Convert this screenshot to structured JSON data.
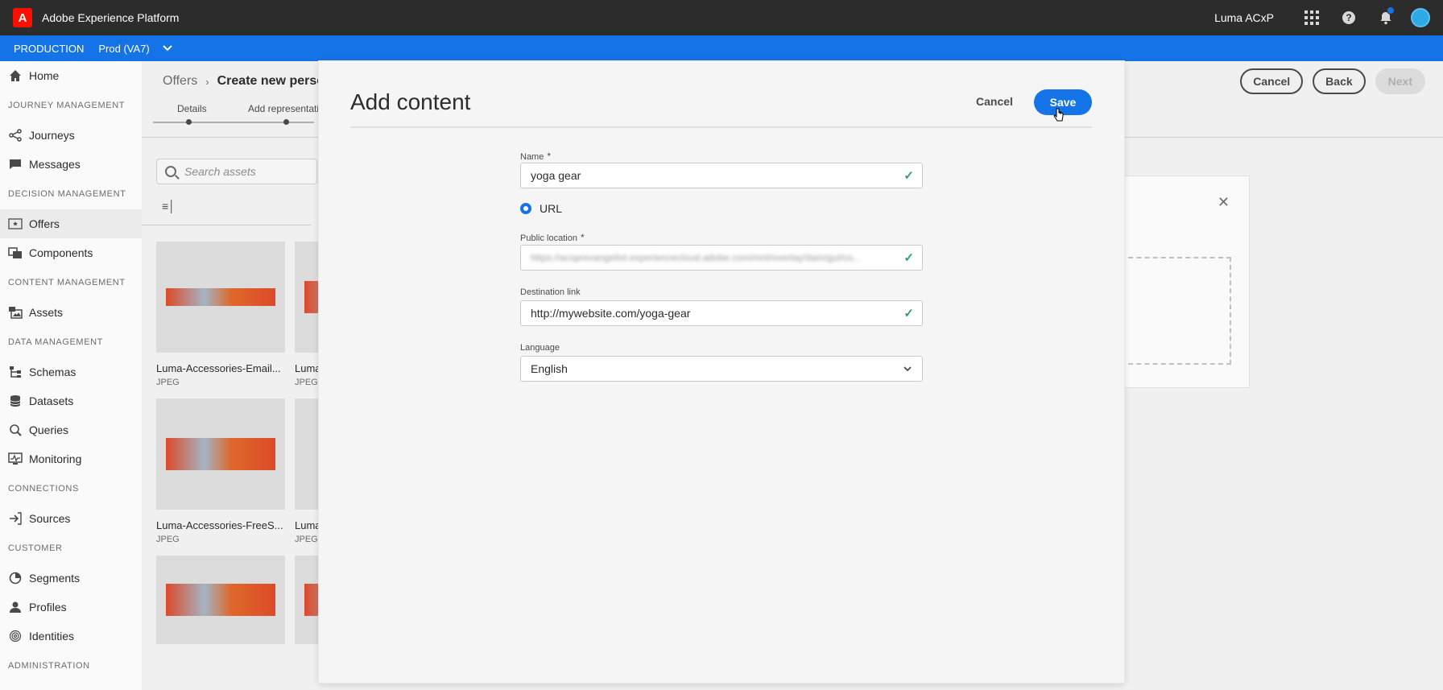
{
  "topbar": {
    "app_title": "Adobe Experience Platform",
    "org_name": "Luma ACxP",
    "icons": [
      "adobe-logo-icon",
      "apps-grid-icon",
      "help-icon",
      "bell-icon",
      "avatar"
    ]
  },
  "envbar": {
    "environment": "PRODUCTION",
    "sandbox": "Prod (VA7)"
  },
  "sidebar": {
    "items": [
      {
        "type": "item",
        "label": "Home",
        "icon": "home-icon"
      },
      {
        "type": "section",
        "label": "JOURNEY MANAGEMENT"
      },
      {
        "type": "item",
        "label": "Journeys",
        "icon": "journeys-icon"
      },
      {
        "type": "item",
        "label": "Messages",
        "icon": "messages-icon"
      },
      {
        "type": "section",
        "label": "DECISION MANAGEMENT"
      },
      {
        "type": "item",
        "label": "Offers",
        "icon": "offers-icon",
        "active": true
      },
      {
        "type": "item",
        "label": "Components",
        "icon": "components-icon"
      },
      {
        "type": "section",
        "label": "CONTENT MANAGEMENT"
      },
      {
        "type": "item",
        "label": "Assets",
        "icon": "assets-icon"
      },
      {
        "type": "section",
        "label": "DATA MANAGEMENT"
      },
      {
        "type": "item",
        "label": "Schemas",
        "icon": "schemas-icon"
      },
      {
        "type": "item",
        "label": "Datasets",
        "icon": "datasets-icon"
      },
      {
        "type": "item",
        "label": "Queries",
        "icon": "queries-icon"
      },
      {
        "type": "item",
        "label": "Monitoring",
        "icon": "monitoring-icon"
      },
      {
        "type": "section",
        "label": "CONNECTIONS"
      },
      {
        "type": "item",
        "label": "Sources",
        "icon": "sources-icon"
      },
      {
        "type": "section",
        "label": "CUSTOMER"
      },
      {
        "type": "item",
        "label": "Segments",
        "icon": "segments-icon"
      },
      {
        "type": "item",
        "label": "Profiles",
        "icon": "profiles-icon"
      },
      {
        "type": "item",
        "label": "Identities",
        "icon": "identities-icon"
      },
      {
        "type": "section",
        "label": "ADMINISTRATION"
      }
    ]
  },
  "background": {
    "breadcrumb": {
      "parent": "Offers",
      "current": "Create new persona"
    },
    "buttons": {
      "cancel": "Cancel",
      "back": "Back",
      "next": "Next"
    },
    "steps": [
      "Details",
      "Add representation"
    ],
    "search_placeholder": "Search assets",
    "assets": [
      {
        "name": "Luma-Accessories-Email...",
        "type": "JPEG"
      },
      {
        "name": "Luma",
        "type": "JPEG"
      },
      {
        "name": "Luma-Accessories-FreeS...",
        "type": "JPEG"
      },
      {
        "name": "Luma",
        "type": "JPEG"
      }
    ]
  },
  "modal": {
    "title": "Add content",
    "cancel_label": "Cancel",
    "save_label": "Save",
    "fields": {
      "name": {
        "label": "Name",
        "value": "yoga gear"
      },
      "source_option": "URL",
      "public_location": {
        "label": "Public location",
        "value": "https://acsprevangelist.experiencecloud.adobe.com/mnt/overlay/dam/gui/co..."
      },
      "destination_link": {
        "label": "Destination link",
        "value": "http://mywebsite.com/yoga-gear"
      },
      "language": {
        "label": "Language",
        "value": "English"
      }
    },
    "required_marker": "*",
    "accent_color": "#1473e6",
    "valid_color": "#2d9d78"
  }
}
